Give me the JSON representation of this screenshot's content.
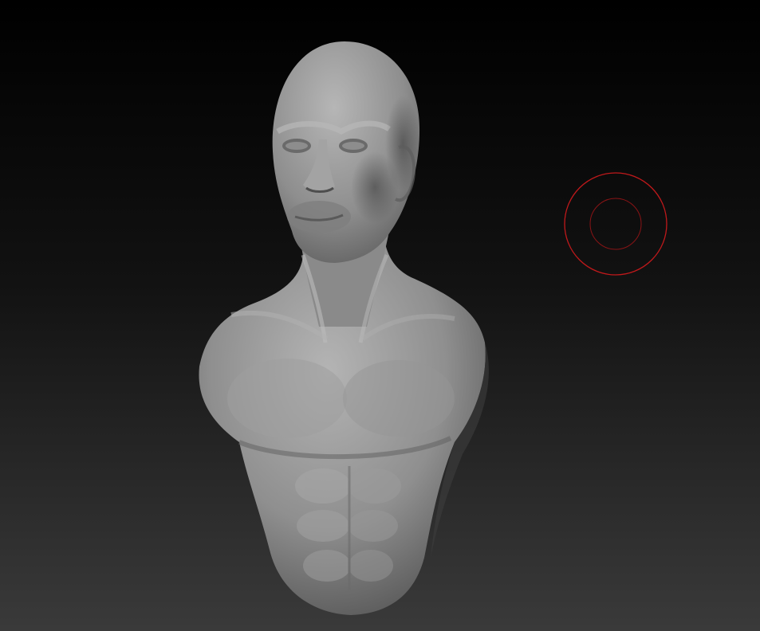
{
  "canvas": {
    "background_top": "#000000",
    "background_bottom": "#3a3a3a",
    "material_light": "#a8a8a8",
    "material_mid": "#8c8c8c",
    "material_dark": "#4a4a4a"
  },
  "model": {
    "icon": "sculpted-bust"
  },
  "brush": {
    "icon": "brush-cursor-icon",
    "color": "#c0191b"
  }
}
